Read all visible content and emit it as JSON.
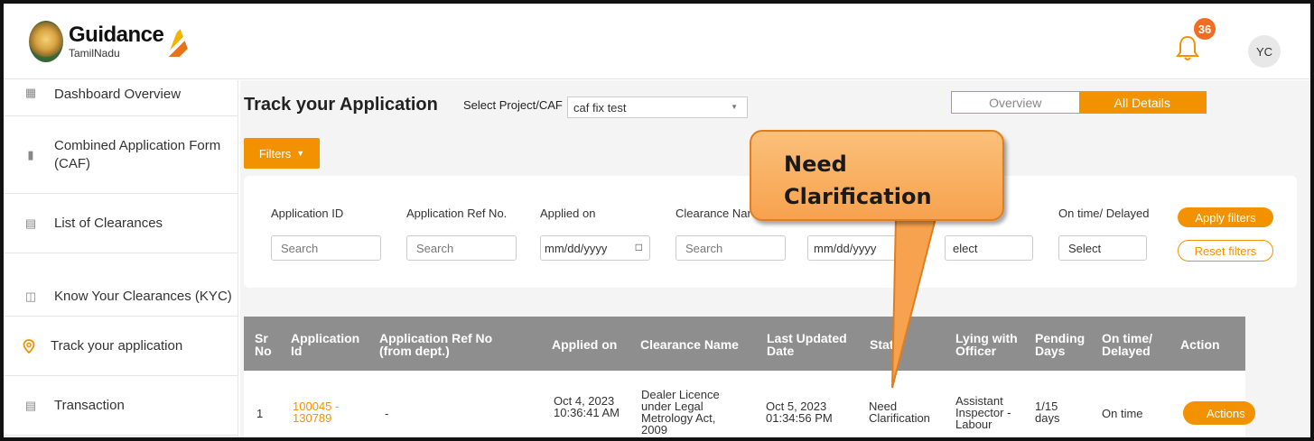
{
  "header": {
    "logo_main": "Guidance",
    "logo_sub": "TamilNadu",
    "notification_count": "36",
    "avatar_initials": "YC"
  },
  "sidebar": {
    "items": [
      {
        "label": "Dashboard Overview",
        "icon": "grid-icon"
      },
      {
        "label": "Combined Application Form (CAF)",
        "icon": "document-icon"
      },
      {
        "label": "List of Clearances",
        "icon": "list-icon"
      },
      {
        "label": "Know Your Clearances (KYC)",
        "icon": "book-icon"
      },
      {
        "label": "Track your application",
        "icon": "location-pin-icon"
      },
      {
        "label": "Transaction",
        "icon": "card-icon"
      }
    ]
  },
  "main": {
    "title": "Track your Application",
    "project_label": "Select Project/CAF",
    "project_value": "caf fix test",
    "tabs": [
      "Overview",
      "All Details"
    ],
    "filters_label": "Filters",
    "filters": {
      "app_id_label": "Application ID",
      "app_ref_label": "Application Ref No.",
      "applied_on_label": "Applied on",
      "clearance_label": "Clearance Nar",
      "ontime_label": "On time/ Delayed",
      "search_placeholder": "Search",
      "date_placeholder": "mm/dd/yyyy",
      "select_placeholder": "Select",
      "select_partial": "elect",
      "apply_label": "Apply filters",
      "reset_label": "Reset filters"
    },
    "table": {
      "headers": {
        "sr": "Sr No",
        "app_id": "Application Id",
        "app_ref": "Application Ref No (from dept.)",
        "applied_on": "Applied on",
        "clearance": "Clearance Name",
        "last_updated": "Last Updated Date",
        "status": "Stat",
        "lying": "Lying with Officer",
        "pending": "Pending Days",
        "ontime": "On time/ Delayed",
        "action": "Action"
      },
      "rows": [
        {
          "sr": "1",
          "app_id": "100045 - 130789",
          "app_ref": "-",
          "applied_on": "Oct 4, 2023 10:36:41 AM",
          "clearance": "Dealer Licence under Legal Metrology Act, 2009",
          "last_updated": "Oct 5, 2023 01:34:56 PM",
          "status": "Need Clarification",
          "lying": "Assistant Inspector - Labour",
          "pending": "1/15 days",
          "ontime": "On time",
          "action": "Actions"
        }
      ]
    }
  },
  "callout": {
    "text": "Need Clarification"
  },
  "colors": {
    "accent": "#f39200",
    "badge": "#f26d21",
    "table_header": "#8e8e8e"
  }
}
